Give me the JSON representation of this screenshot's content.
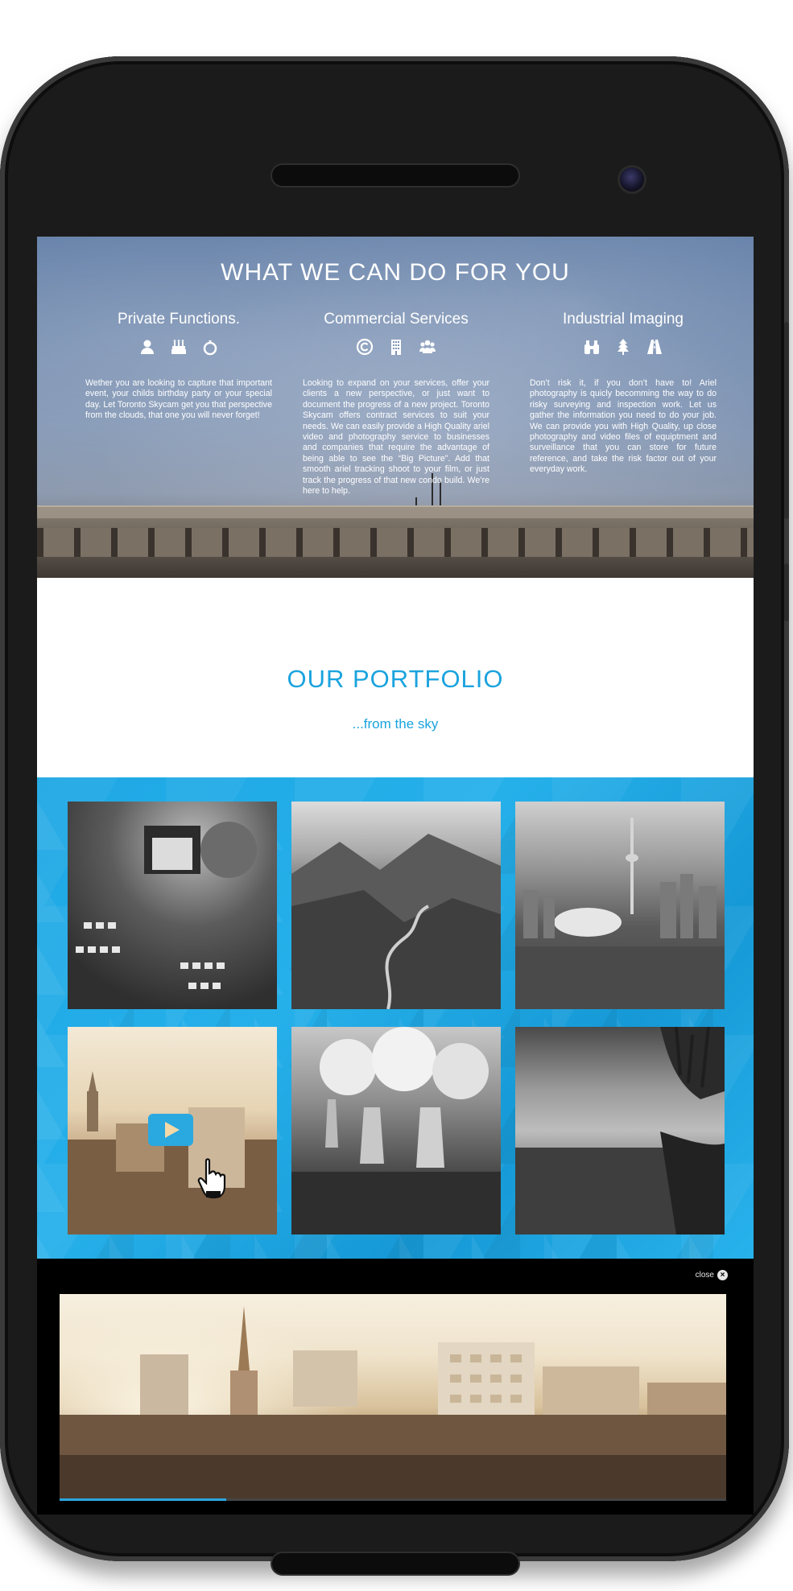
{
  "services": {
    "title": "WHAT WE CAN DO FOR YOU",
    "columns": [
      {
        "heading": "Private Functions.",
        "icons": [
          "user-icon",
          "birthday-cake-icon",
          "wedding-ring-icon"
        ],
        "text": "Wether you are looking to capture that important event, your childs birthday party or your special day. Let Toronto Skycam get you that perspective from the clouds, that one you will never forget!"
      },
      {
        "heading": "Commercial Services",
        "icons": [
          "copyright-icon",
          "office-building-icon",
          "users-group-icon"
        ],
        "text": "Looking to expand on your services, offer your clients a new perspective, or just want to document the progress of a new project. Toronto Skycam offers contract services to suit your needs. We can easily provide a High Quality ariel video and photography service to businesses and companies that require the advantage of being able to see the “Big Picture”. Add that smooth ariel tracking shoot to your film, or just track the progress of that new condo build. We’re here to help."
      },
      {
        "heading": "Industrial Imaging",
        "icons": [
          "binoculars-icon",
          "tree-icon",
          "road-icon"
        ],
        "text": "Don’t risk it, if you don’t have to! Ariel photography is quicly becomming the way to do risky surveying and inspection work. Let us gather the information you need to do your job. We can provide you with High Quality, up close photography and video files of equiptment and surveillance that you can store for future reference, and take the risk factor out of your everyday work."
      }
    ]
  },
  "portfolio": {
    "title": "OUR PORTFOLIO",
    "subtitle": "...from the sky"
  },
  "video": {
    "close_label": "close",
    "progress": 0.25
  },
  "colors": {
    "accent": "#1aa3de",
    "gallery_bg": "#1ea7e4"
  }
}
